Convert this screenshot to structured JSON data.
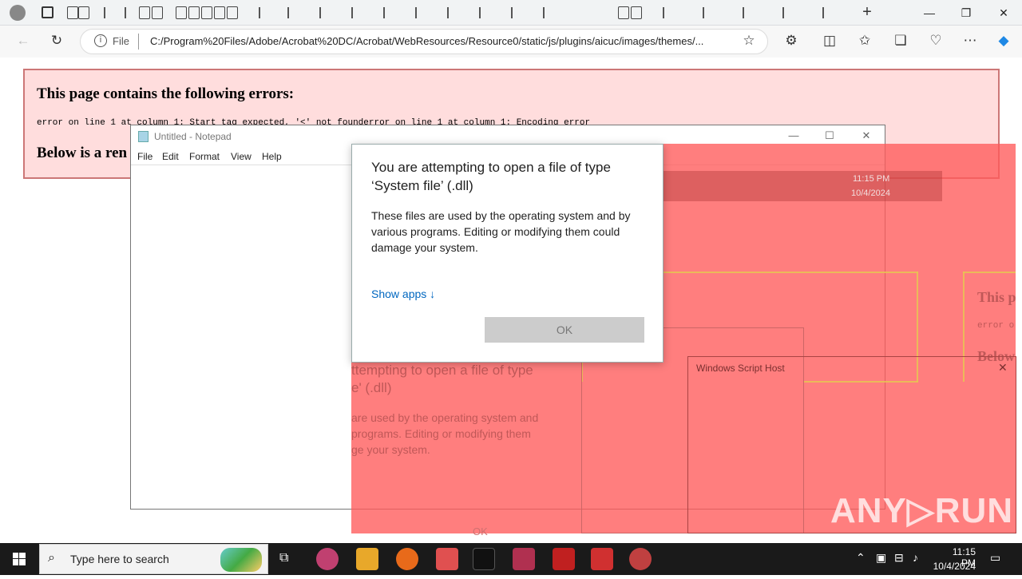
{
  "browser": {
    "address_scheme_label": "File",
    "address_url": "C:/Program%20Files/Adobe/Acrobat%20DC/Acrobat/WebResources/Resource0/static/js/plugins/aicuc/images/themes/...",
    "new_tab_label": "+",
    "minimize_label": "—",
    "restore_label": "❐",
    "close_label": "✕"
  },
  "xml_error": {
    "title": "This page contains the following errors:",
    "detail": "error on line 1 at column 1: Start tag expected, '<' not founderror on line 1 at column 1: Encoding error",
    "below": "Below is a ren"
  },
  "notepad": {
    "title": "Untitled - Notepad",
    "menu": [
      "File",
      "Edit",
      "Format",
      "View",
      "Help"
    ]
  },
  "ghost": {
    "line1": "ttempting to open a file of type",
    "line2": "e' (.dll)",
    "line3": "are used by the operating system and",
    "line4": "programs. Editing or modifying them",
    "line5": "ge your system.",
    "right_title": "This p",
    "right_err": "error o",
    "right_below": "Below",
    "time": "11:15 PM",
    "date": "10/4/2024",
    "ok": "OK",
    "wsh_title": "Windows Script Host"
  },
  "dialog": {
    "title": "You are attempting to open a file of type ‘System file’ (.dll)",
    "body": "These files are used by the operating system and by various programs. Editing or modifying them could damage your system.",
    "show_apps": "Show apps ↓",
    "ok": "OK"
  },
  "watermark": "ANY▷RUN",
  "taskbar": {
    "search_placeholder": "Type here to search",
    "time": "11:15 PM",
    "date": "10/4/2024"
  },
  "colors": {
    "overlay": "#ff5a5a",
    "error_bg": "#ffdddd",
    "link": "#0067c0"
  }
}
